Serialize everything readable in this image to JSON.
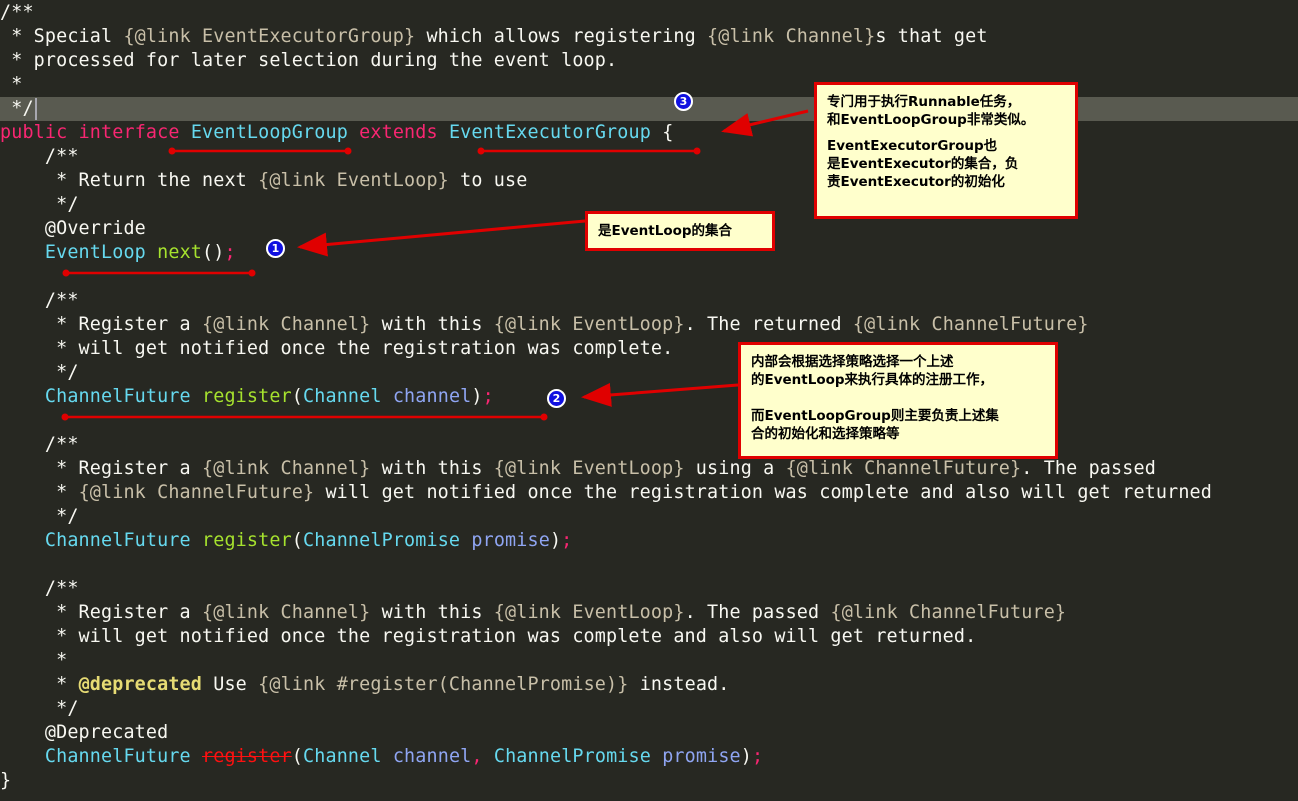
{
  "editor": {
    "theme_colors": {
      "background": "#272822",
      "current_line": "#595a50",
      "keyword": "#f92672",
      "type": "#66d9ef",
      "function": "#a6e22e",
      "parameter": "#8fa5f2",
      "comment_link": "#c8bfa8",
      "annotation_tag": "#e6db74",
      "deprecated": "#ff1010"
    },
    "code": {
      "l1": "/**",
      "l2_a": " * Special ",
      "l2_link": "{@link EventExecutorGroup}",
      "l2_b": " which allows registering ",
      "l2_link2": "{@link Channel}",
      "l2_c": "s that get",
      "l3": " * processed for later selection during the event loop.",
      "l4": " *",
      "l5": " */",
      "l6_public": "public",
      "l6_interface": "interface",
      "l6_name": "EventLoopGroup",
      "l6_extends": "extends",
      "l6_super": "EventExecutorGroup",
      "l6_brace": "{",
      "l7": "    /**",
      "l8_a": "     * Return the next ",
      "l8_link": "{@link EventLoop}",
      "l8_b": " to use",
      "l9": "     */",
      "l10": "    @Override",
      "l11_type": "EventLoop",
      "l11_fn": "next",
      "l11_paren": "()",
      "l11_semi": ";",
      "l13": "    /**",
      "l14_a": "     * Register a ",
      "l14_link1": "{@link Channel}",
      "l14_b": " with this ",
      "l14_link2": "{@link EventLoop}",
      "l14_c": ". The returned ",
      "l14_link3": "{@link ChannelFuture}",
      "l15": "     * will get notified once the registration was complete.",
      "l16": "     */",
      "l17_type": "ChannelFuture",
      "l17_fn": "register",
      "l17_open": "(",
      "l17_ptype": "Channel",
      "l17_pname": "channel",
      "l17_close": ")",
      "l17_semi": ";",
      "l19": "    /**",
      "l20_a": "     * Register a ",
      "l20_link1": "{@link Channel}",
      "l20_b": " with this ",
      "l20_link2": "{@link EventLoop}",
      "l20_c": " using a ",
      "l20_link3": "{@link ChannelFuture}",
      "l20_d": ". The passed",
      "l21_a": "     * ",
      "l21_link": "{@link ChannelFuture}",
      "l21_b": " will get notified once the registration was complete and also will get returned",
      "l22": "     */",
      "l23_type": "ChannelFuture",
      "l23_fn": "register",
      "l23_open": "(",
      "l23_ptype": "ChannelPromise",
      "l23_pname": "promise",
      "l23_close": ")",
      "l23_semi": ";",
      "l25": "    /**",
      "l26_a": "     * Register a ",
      "l26_link1": "{@link Channel}",
      "l26_b": " with this ",
      "l26_link2": "{@link EventLoop}",
      "l26_c": ". The passed ",
      "l26_link3": "{@link ChannelFuture}",
      "l27": "     * will get notified once the registration was complete and also will get returned.",
      "l28": "     *",
      "l29_a": "     * ",
      "l29_tag": "@deprecated",
      "l29_b": " Use ",
      "l29_link": "{@link #register(ChannelPromise)}",
      "l29_c": " instead.",
      "l30": "     */",
      "l31": "    @Deprecated",
      "l32_type": "ChannelFuture",
      "l32_fn": "register",
      "l32_open": "(",
      "l32_ptype1": "Channel",
      "l32_pname1": "channel",
      "l32_comma": ",",
      "l32_ptype2": "ChannelPromise",
      "l32_pname2": "promise",
      "l32_close": ")",
      "l32_semi": ";",
      "l33": "}"
    }
  },
  "annotations": {
    "badges": [
      "1",
      "2",
      "3"
    ],
    "note_executor_group": {
      "p1_line1": "专门用于执行Runnable任务，",
      "p1_line2": "和EventLoopGroup非常类似。",
      "p2_line1": "EventExecutorGroup也",
      "p2_line2": "是EventExecutor的集合，负",
      "p2_line3": "责EventExecutor的初始化"
    },
    "note_next": {
      "text": "是EventLoop的集合"
    },
    "note_register": {
      "p1_line1": "内部会根据选择策略选择一个上述",
      "p1_line2": "的EventLoop来执行具体的注册工作，",
      "p2_line1": "而EventLoopGroup则主要负责上述集",
      "p2_line2": "合的初始化和选择策略等"
    },
    "markup_color": "#e00000",
    "badge_color": "#1010e0",
    "note_background": "#ffffcc"
  }
}
